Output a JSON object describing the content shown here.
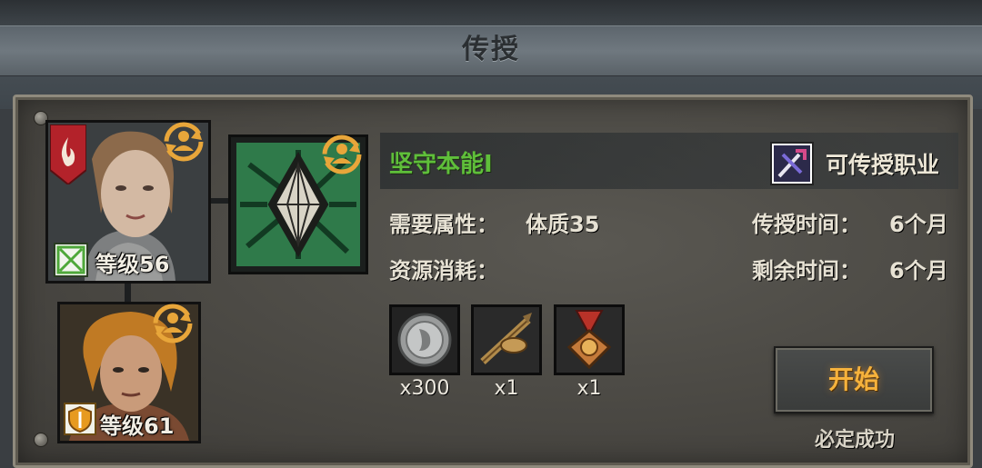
{
  "window": {
    "title": "传授"
  },
  "teacher": {
    "level_label": "等级56"
  },
  "student": {
    "level_label": "等级61"
  },
  "skill": {
    "name": "坚守本能I"
  },
  "job": {
    "label": "可传授职业"
  },
  "requirement": {
    "label": "需要属性：",
    "value": "体质35"
  },
  "teach_time": {
    "label": "传授时间：",
    "value": "6个月"
  },
  "remaining_time": {
    "label": "剩余时间：",
    "value": "6个月"
  },
  "resources": {
    "label": "资源消耗：",
    "items": [
      {
        "icon": "silver-coin-icon",
        "qty": "x300"
      },
      {
        "icon": "scroll-quiver-icon",
        "qty": "x1"
      },
      {
        "icon": "medal-icon",
        "qty": "x1"
      }
    ]
  },
  "start_button": {
    "label": "开始"
  },
  "success_note": "必定成功",
  "colors": {
    "skill_green": "#5fbf3a",
    "start_orange": "#f6b23c",
    "cycle_gold": "#e8a63a"
  }
}
